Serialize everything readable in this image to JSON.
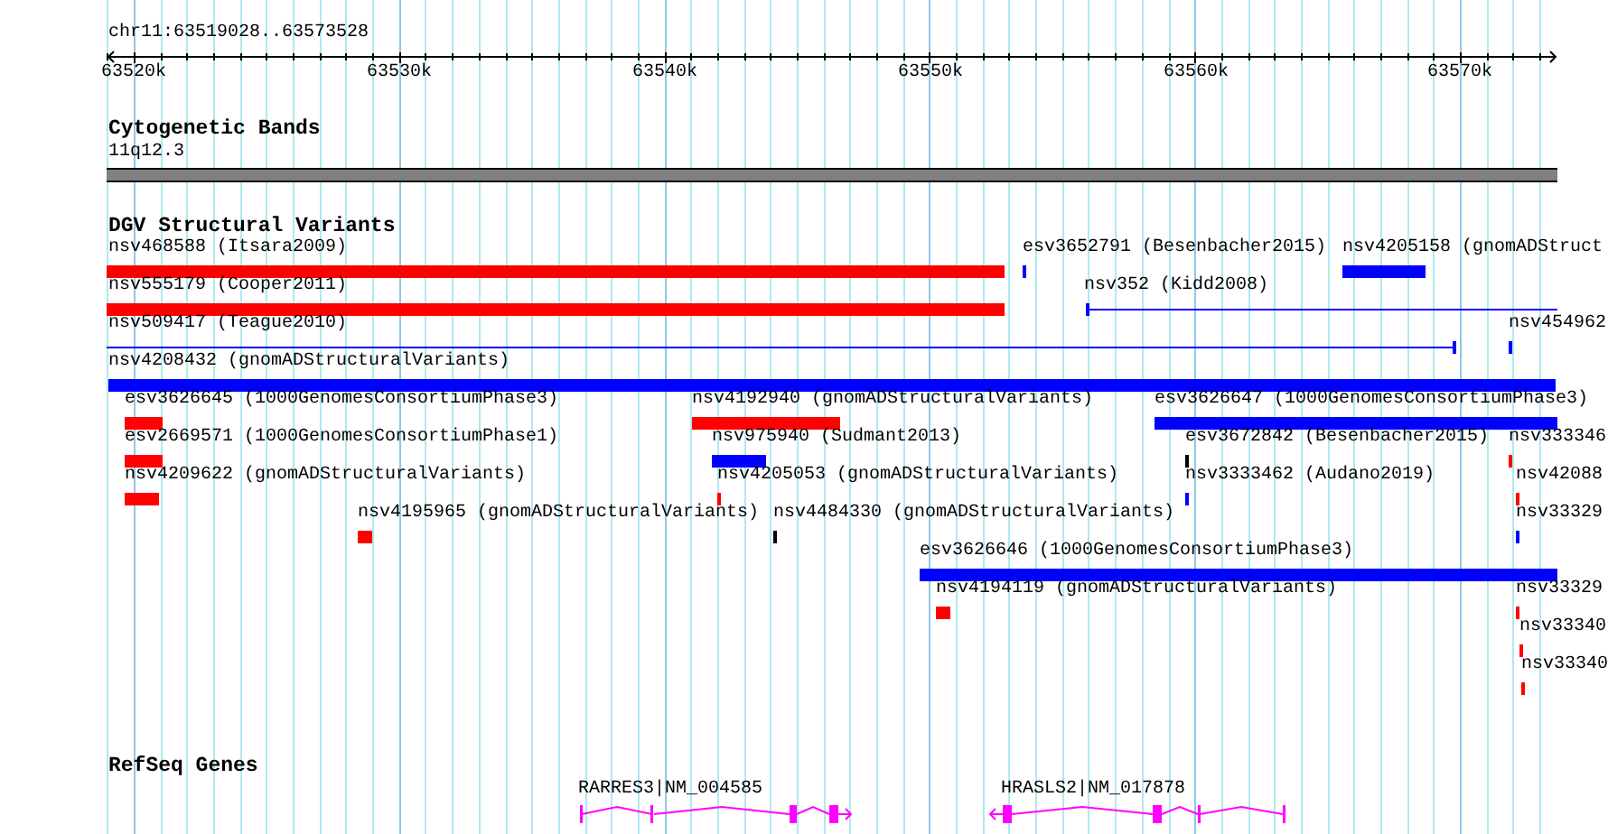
{
  "ruler": {
    "title": "chr11:63519028..63573528",
    "ticks": [
      "63520k",
      "63530k",
      "63540k",
      "63550k",
      "63560k",
      "63570k"
    ]
  },
  "tracks": [
    {
      "kind": "bands",
      "title": "Cytogenetic Bands",
      "band": {
        "label": "11q12.3"
      }
    },
    {
      "kind": "variants",
      "title": "DGV Structural Variants",
      "features": [
        {
          "label": "nsv468588 (Itsara2009)",
          "color": "#ff0000",
          "kind": "bar"
        },
        {
          "label": "esv3652791 (Besenbacher2015)",
          "color": "#0000ff",
          "kind": "bar"
        },
        {
          "label": "nsv4205158 (gnomADStruct",
          "color": "#0000ff",
          "kind": "bar"
        },
        {
          "label": "nsv555179 (Cooper2011)",
          "color": "#ff0000",
          "kind": "bar"
        },
        {
          "label": "nsv352 (Kidd2008)",
          "color": "#0000ff",
          "kind": "line"
        },
        {
          "label": "nsv509417 (Teague2010)",
          "color": "#0000ff",
          "kind": "line"
        },
        {
          "label": "nsv454962",
          "color": "#0000ff",
          "kind": "bar"
        },
        {
          "label": "nsv4208432 (gnomADStructuralVariants)",
          "color": "#0000ff",
          "kind": "bar"
        },
        {
          "label": "esv3626645 (1000GenomesConsortiumPhase3)",
          "color": "#ff0000",
          "kind": "bar"
        },
        {
          "label": "nsv4192940 (gnomADStructuralVariants)",
          "color": "#ff0000",
          "kind": "bar"
        },
        {
          "label": "esv3626647 (1000GenomesConsortiumPhase3)",
          "color": "#0000ff",
          "kind": "bar"
        },
        {
          "label": "esv2669571 (1000GenomesConsortiumPhase1)",
          "color": "#ff0000",
          "kind": "bar"
        },
        {
          "label": "nsv975940 (Sudmant2013)",
          "color": "#0000ff",
          "kind": "bar"
        },
        {
          "label": "esv3672842 (Besenbacher2015)",
          "color": "#000000",
          "kind": "bar"
        },
        {
          "label": "nsv333346",
          "color": "#ff0000",
          "kind": "bar"
        },
        {
          "label": "nsv4209622 (gnomADStructuralVariants)",
          "color": "#ff0000",
          "kind": "bar"
        },
        {
          "label": "nsv4205053 (gnomADStructuralVariants)",
          "color": "#ff0000",
          "kind": "bar"
        },
        {
          "label": "nsv3333462 (Audano2019)",
          "color": "#0000ff",
          "kind": "bar"
        },
        {
          "label": "nsv42088",
          "color": "#ff0000",
          "kind": "bar"
        },
        {
          "label": "nsv4195965 (gnomADStructuralVariants)",
          "color": "#ff0000",
          "kind": "bar"
        },
        {
          "label": "nsv4484330 (gnomADStructuralVariants)",
          "color": "#000000",
          "kind": "bar"
        },
        {
          "label": "nsv33329",
          "color": "#0000ff",
          "kind": "bar"
        },
        {
          "label": "esv3626646 (1000GenomesConsortiumPhase3)",
          "color": "#0000ff",
          "kind": "bar"
        },
        {
          "label": "nsv4194119 (gnomADStructuralVariants)",
          "color": "#ff0000",
          "kind": "bar"
        },
        {
          "label": "nsv33329",
          "color": "#ff0000",
          "kind": "bar"
        },
        {
          "label": "nsv33340",
          "color": "#ff0000",
          "kind": "bar"
        },
        {
          "label": "nsv33340",
          "color": "#ff0000",
          "kind": "bar"
        }
      ]
    },
    {
      "kind": "genes",
      "title": "RefSeq Genes",
      "genes": [
        {
          "label": "RARRES3|NM_004585"
        },
        {
          "label": "HRASLS2|NM_017878"
        }
      ]
    }
  ]
}
